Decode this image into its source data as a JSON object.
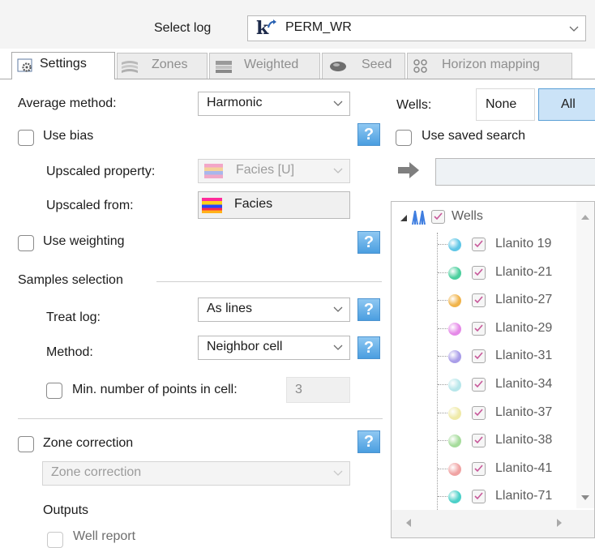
{
  "header": {
    "select_log_label": "Select log",
    "log_value": "PERM_WR",
    "log_icon": "k-log-icon"
  },
  "tabs": [
    {
      "label": "Settings",
      "icon": "settings-gear-icon"
    },
    {
      "label": "Zones",
      "icon": "zones-icon"
    },
    {
      "label": "Weighted",
      "icon": "weighted-icon"
    },
    {
      "label": "Seed",
      "icon": "seed-icon"
    },
    {
      "label": "Horizon mapping",
      "icon": "horizon-mapping-icon"
    }
  ],
  "settings": {
    "average_method_label": "Average method:",
    "average_method_value": "Harmonic",
    "use_bias_label": "Use bias",
    "upscaled_property_label": "Upscaled property:",
    "upscaled_property_value": "Facies [U]",
    "upscaled_from_label": "Upscaled from:",
    "upscaled_from_value": "Facies",
    "use_weighting_label": "Use weighting",
    "samples_selection_label": "Samples selection",
    "treat_log_label": "Treat log:",
    "treat_log_value": "As lines",
    "method_label": "Method:",
    "method_value": "Neighbor cell",
    "min_points_label": "Min. number of points in cell:",
    "min_points_value": "3",
    "zone_correction_label": "Zone correction",
    "zone_correction_select": "Zone correction",
    "outputs_label": "Outputs",
    "well_report_label": "Well report",
    "help_text": "?"
  },
  "wells": {
    "label": "Wells:",
    "none_button": "None",
    "all_button": "All",
    "use_saved_search_label": "Use saved search",
    "root_label": "Wells",
    "items": [
      {
        "name": "Llanito 19",
        "color": "#5fc6e6"
      },
      {
        "name": "Llanito-21",
        "color": "#4ccf9e"
      },
      {
        "name": "Llanito-27",
        "color": "#f0b34a"
      },
      {
        "name": "Llanito-29",
        "color": "#e58ae8"
      },
      {
        "name": "Llanito-31",
        "color": "#a99de8"
      },
      {
        "name": "Llanito-34",
        "color": "#b7e6ea"
      },
      {
        "name": "Llanito-37",
        "color": "#efeaa8"
      },
      {
        "name": "Llanito-38",
        "color": "#a6dc9c"
      },
      {
        "name": "Llanito-41",
        "color": "#f0a3a3"
      },
      {
        "name": "Llanito-71",
        "color": "#4cd0c8"
      }
    ]
  }
}
